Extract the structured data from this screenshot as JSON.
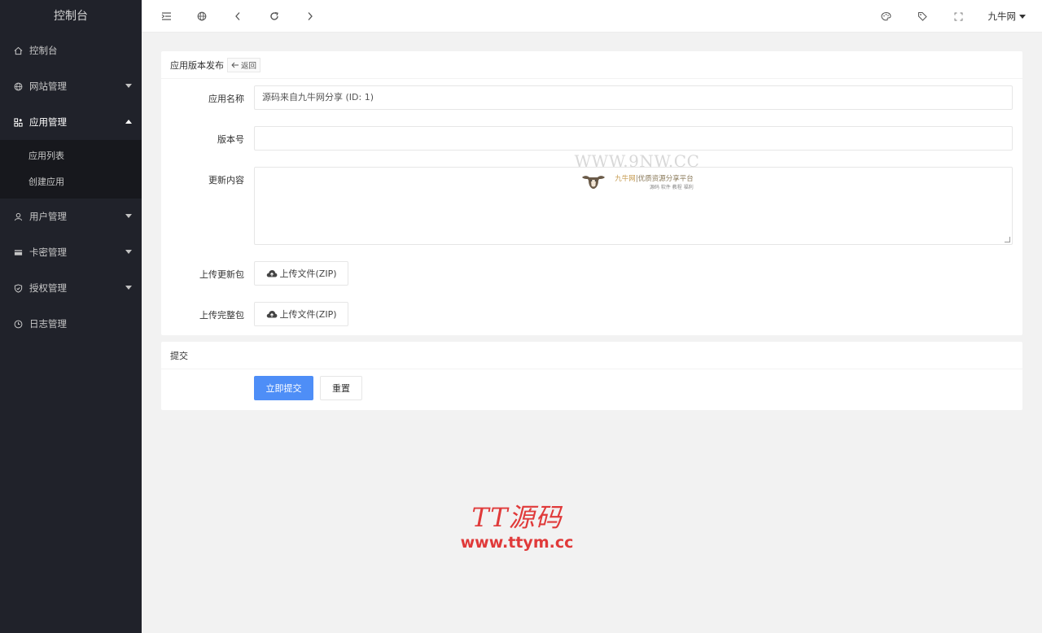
{
  "sidebar": {
    "title": "控制台",
    "items": [
      {
        "label": "控制台",
        "icon": "home-icon",
        "has_caret": false
      },
      {
        "label": "网站管理",
        "icon": "globe-icon",
        "has_caret": true
      },
      {
        "label": "应用管理",
        "icon": "apps-icon",
        "has_caret": true,
        "open": true
      },
      {
        "label": "用户管理",
        "icon": "user-icon",
        "has_caret": true
      },
      {
        "label": "卡密管理",
        "icon": "card-icon",
        "has_caret": true
      },
      {
        "label": "授权管理",
        "icon": "shield-icon",
        "has_caret": true
      },
      {
        "label": "日志管理",
        "icon": "clock-icon",
        "has_caret": false
      }
    ],
    "sub_items": [
      {
        "label": "应用列表"
      },
      {
        "label": "创建应用"
      }
    ]
  },
  "header": {
    "left_icons": [
      "menu-fold-icon",
      "globe-icon",
      "chevron-left-icon",
      "refresh-icon",
      "chevron-right-icon"
    ],
    "right_icons": [
      "palette-icon",
      "tag-icon",
      "fullscreen-icon"
    ],
    "user_label": "九牛网"
  },
  "form_card": {
    "title": "应用版本发布",
    "back_label": "返回",
    "fields": {
      "app_name": {
        "label": "应用名称",
        "value": "源码来自九牛网分享 (ID: 1)"
      },
      "version": {
        "label": "版本号",
        "value": ""
      },
      "content": {
        "label": "更新内容",
        "value": ""
      },
      "update_pkg": {
        "label": "上传更新包",
        "button": "上传文件(ZIP)"
      },
      "full_pkg": {
        "label": "上传完整包",
        "button": "上传文件(ZIP)"
      }
    }
  },
  "submit_card": {
    "title": "提交",
    "submit_label": "立即提交",
    "reset_label": "重置"
  },
  "watermarks": {
    "site1_url": "WWW.9NW.CC",
    "site1_brand": "九牛网",
    "site1_slogan": "优质资源分享平台",
    "site1_tags": "源码 软件 教程 福利",
    "site2_name": "TT源码",
    "site2_url": "www.ttym.cc"
  },
  "colors": {
    "sidebar_bg": "#20222a",
    "primary": "#4e8ef7",
    "watermark_red": "#e03a3a"
  }
}
